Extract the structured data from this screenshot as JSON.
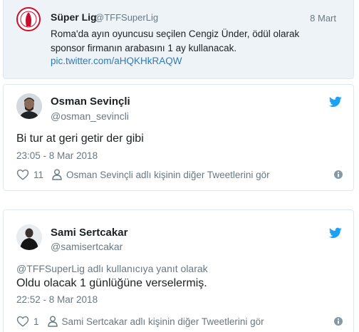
{
  "quoted": {
    "name": "Süper Lig",
    "handle": "@TFFSuperLig",
    "date": "8 Mart",
    "text": "Roma'da ayın oyuncusu seçilen Cengiz Ünder, ödül olarak sponsor firmanın arabasını 1 ay kullanacak.",
    "link": "pic.twitter.com/aHQKHkRAQW"
  },
  "tweets": [
    {
      "name": "Osman Sevinçli",
      "handle": "@osman_sevincli",
      "text": "Bi tur at geri getir der gibi",
      "time": "23:05 - 8 Mar 2018",
      "likes": "11",
      "more_label": "Osman Sevinçli adlı kişinin diğer Tweetlerini gör"
    },
    {
      "name": "Sami Sertcakar",
      "handle": "@samisertcakar",
      "reply_to": "@TFFSuperLig adlı kullanıcıya yanıt olarak",
      "text": "Oldu olacak 1 günlüğüne verselermiş.",
      "time": "22:52 - 8 Mar 2018",
      "likes": "1",
      "more_label": "Sami Sertcakar adlı kişinin diğer Tweetlerini gör"
    }
  ],
  "colors": {
    "twitter_blue": "#1da1f2",
    "link": "#2b7bb9",
    "muted": "#697882",
    "quote_bg": "#eef3f8"
  },
  "icons": [
    "super-lig-logo-icon",
    "twitter-bird-icon",
    "heart-icon",
    "person-icon",
    "info-icon"
  ]
}
